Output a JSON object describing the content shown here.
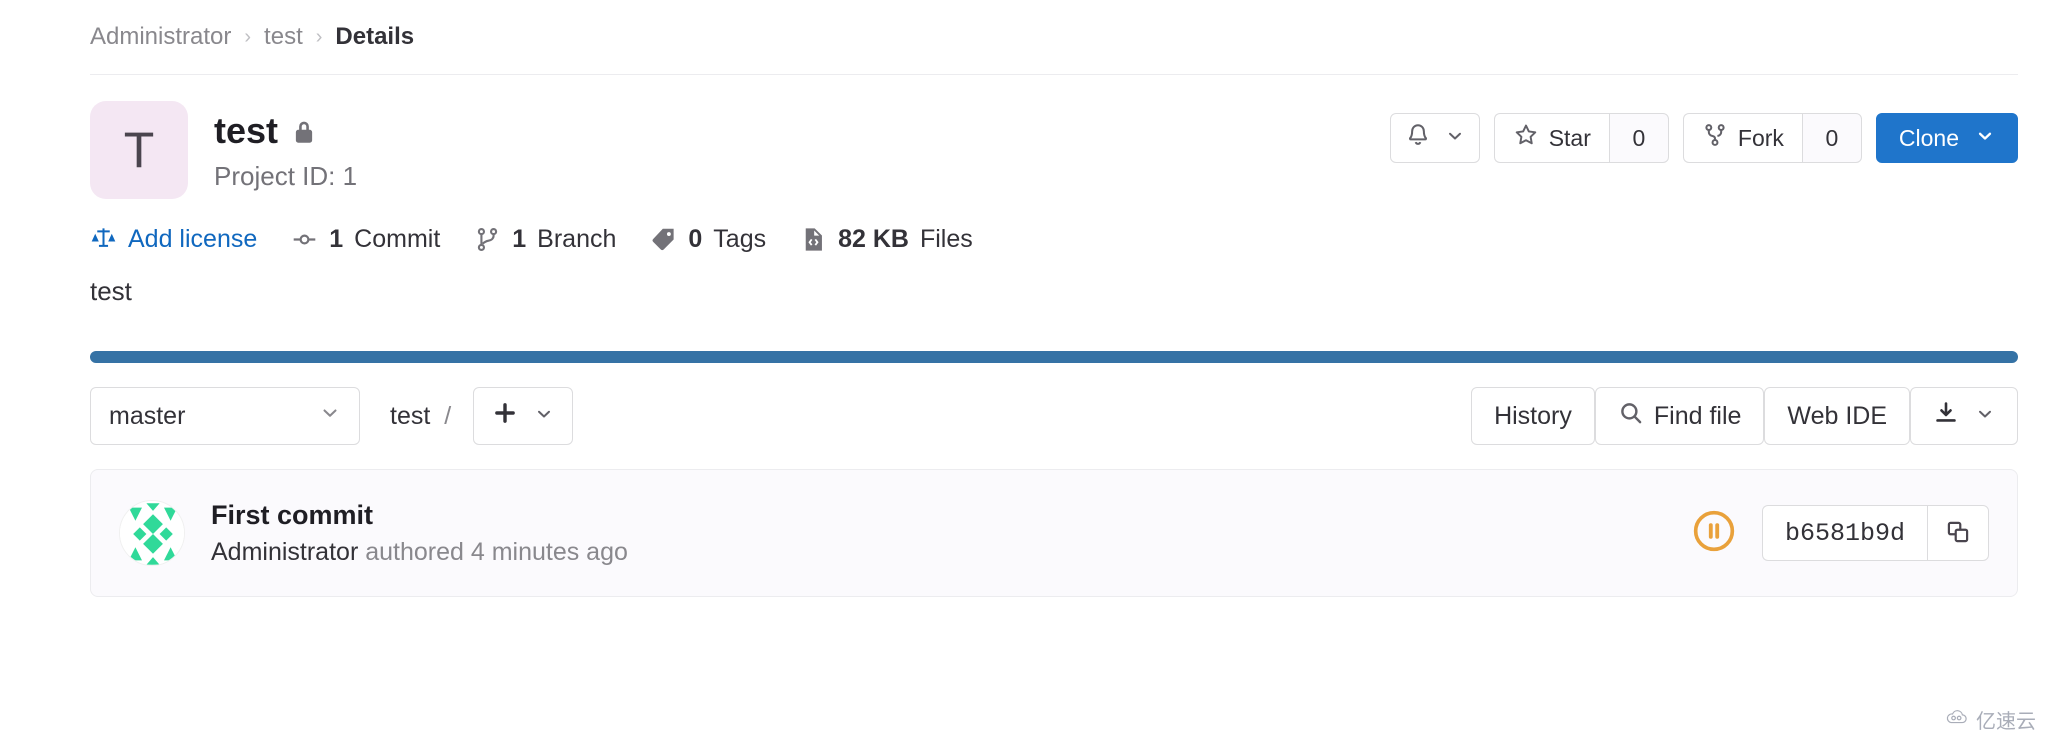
{
  "breadcrumb": {
    "items": [
      {
        "label": "Administrator",
        "current": false
      },
      {
        "label": "test",
        "current": false
      },
      {
        "label": "Details",
        "current": true
      }
    ],
    "separator": "›"
  },
  "project": {
    "avatar_letter": "T",
    "avatar_bg": "#f4e7f3",
    "name": "test",
    "visibility_icon": "lock-icon",
    "project_id_label": "Project ID: 1",
    "description": "test"
  },
  "header_actions": {
    "notify_icon": "bell-icon",
    "notify_caret_icon": "chevron-down-icon",
    "star": {
      "icon": "star-icon",
      "label": "Star",
      "count": "0"
    },
    "fork": {
      "icon": "fork-icon",
      "label": "Fork",
      "count": "0"
    },
    "clone": {
      "label": "Clone",
      "caret_icon": "chevron-down-icon",
      "color": "#1f75cb"
    }
  },
  "stats": [
    {
      "icon": "scale-icon",
      "text": "Add license",
      "link": true
    },
    {
      "icon": "commit-icon",
      "value": "1",
      "unit": "Commit",
      "link": false
    },
    {
      "icon": "branch-icon",
      "value": "1",
      "unit": "Branch",
      "link": false
    },
    {
      "icon": "tag-icon",
      "value": "0",
      "unit": "Tags",
      "link": false
    },
    {
      "icon": "file-code-icon",
      "value": "82 KB",
      "unit": "Files",
      "link": false
    }
  ],
  "language_bar": {
    "segments": [
      {
        "name": "primary",
        "color": "#3572a5",
        "percent": 100
      }
    ]
  },
  "repo_toolbar": {
    "branch": {
      "value": "master",
      "caret_icon": "chevron-down-icon"
    },
    "path": {
      "root": "test",
      "separator": "/"
    },
    "add_button": {
      "icon": "plus-icon",
      "caret_icon": "chevron-down-icon"
    },
    "history_label": "History",
    "find_file": {
      "icon": "search-icon",
      "label": "Find file"
    },
    "web_ide_label": "Web IDE",
    "download": {
      "icon": "download-icon",
      "caret_icon": "chevron-down-icon"
    }
  },
  "last_commit": {
    "avatar_icon": "identicon-avatar",
    "title": "First commit",
    "author": "Administrator",
    "meta": " authored 4 minutes ago",
    "pipeline_status": {
      "icon": "pipeline-pending-icon",
      "color": "#e9a13b"
    },
    "sha": "b6581b9d",
    "copy_icon": "copy-icon"
  },
  "watermark": {
    "icon": "cloud-icon",
    "text": "亿速云"
  }
}
